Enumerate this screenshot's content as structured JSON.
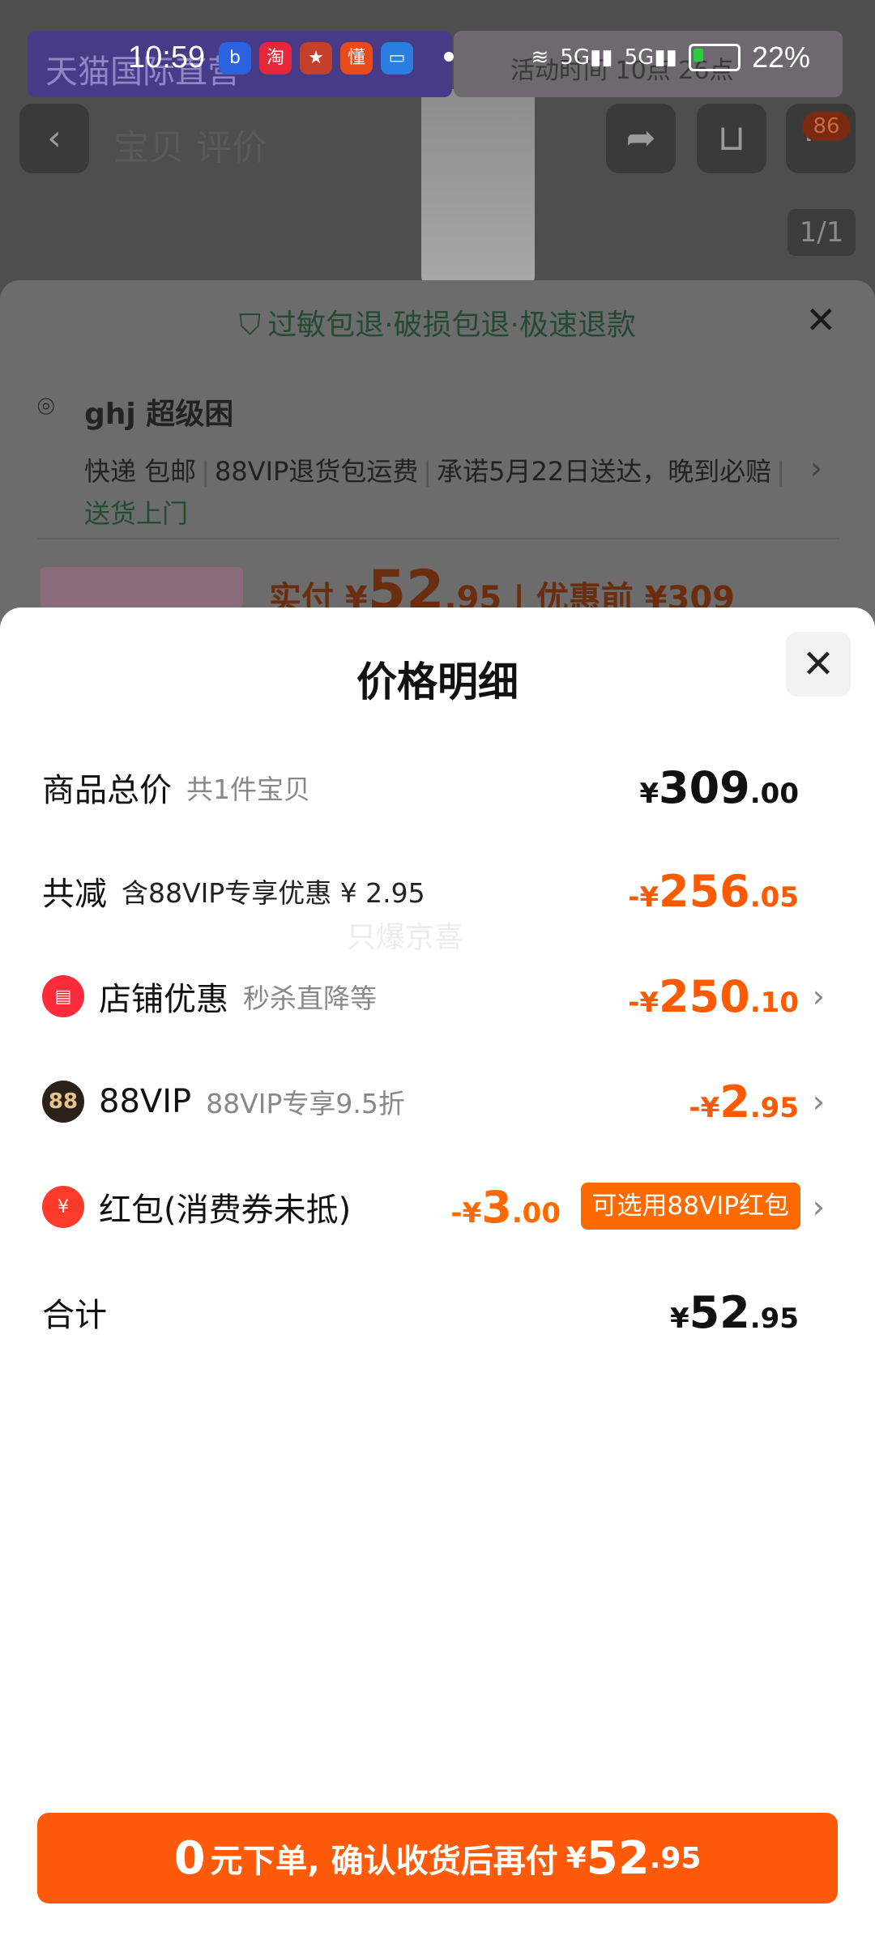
{
  "status_bar": {
    "time": "10:59",
    "ad_left": "天猫国际直营",
    "ad_right": "活动时间 10点 26点",
    "notif_icons": [
      "baidu-icon",
      "taobao-icon",
      "game-icon",
      "app-icon",
      "wallet-icon"
    ],
    "network_1": "5G",
    "network_2": "5G",
    "battery_percent": "22%"
  },
  "background_page": {
    "tabs_text": "宝贝  评价",
    "cart_badge": "86",
    "image_indicator": "1/1",
    "guarantee": "过敏包退·破损包退·极速退款",
    "address_name": "ghj 超级困",
    "delivery_items": [
      "快递 包邮",
      "88VIP退货包运费",
      "承诺5月22日送达，晚到必赔"
    ],
    "delivery_extra": "送货上门",
    "price_label": "实付 ¥",
    "price_int": "52",
    "price_dec": ".95",
    "price_before": "| 优惠前 ¥309"
  },
  "modal": {
    "title": "价格明细",
    "watermark": "只爆京喜",
    "rows": {
      "total": {
        "label": "商品总价",
        "sub": "共1件宝贝",
        "yen": "¥",
        "int": "309",
        "dec": ".00"
      },
      "reduction": {
        "label": "共减",
        "sub": "含88VIP专享优惠 ¥ 2.95",
        "minus": "-",
        "yen": "¥",
        "int": "256",
        "dec": ".05"
      },
      "store": {
        "label": "店铺优惠",
        "sub": "秒杀直降等",
        "minus": "-",
        "yen": "¥",
        "int": "250",
        "dec": ".10"
      },
      "vip": {
        "label": "88VIP",
        "sub": "88VIP专享9.5折",
        "icon_text": "88",
        "minus": "-",
        "yen": "¥",
        "int": "2",
        "dec": ".95"
      },
      "red_packet": {
        "label": "红包(消费券未抵)",
        "minus": "-",
        "yen": "¥",
        "int": "3",
        "dec": ".00",
        "tag": "可选用88VIP红包"
      },
      "sum": {
        "label": "合计",
        "yen": "¥",
        "int": "52",
        "dec": ".95"
      }
    }
  },
  "pay_button": {
    "zero": "0",
    "text": "元下单, 确认收货后再付",
    "yen": "¥",
    "int": "52",
    "dec": ".95"
  },
  "colors": {
    "accent": "#ff5a0a",
    "discount": "#ff5a00",
    "guarantee_green": "#1f7a3e"
  }
}
